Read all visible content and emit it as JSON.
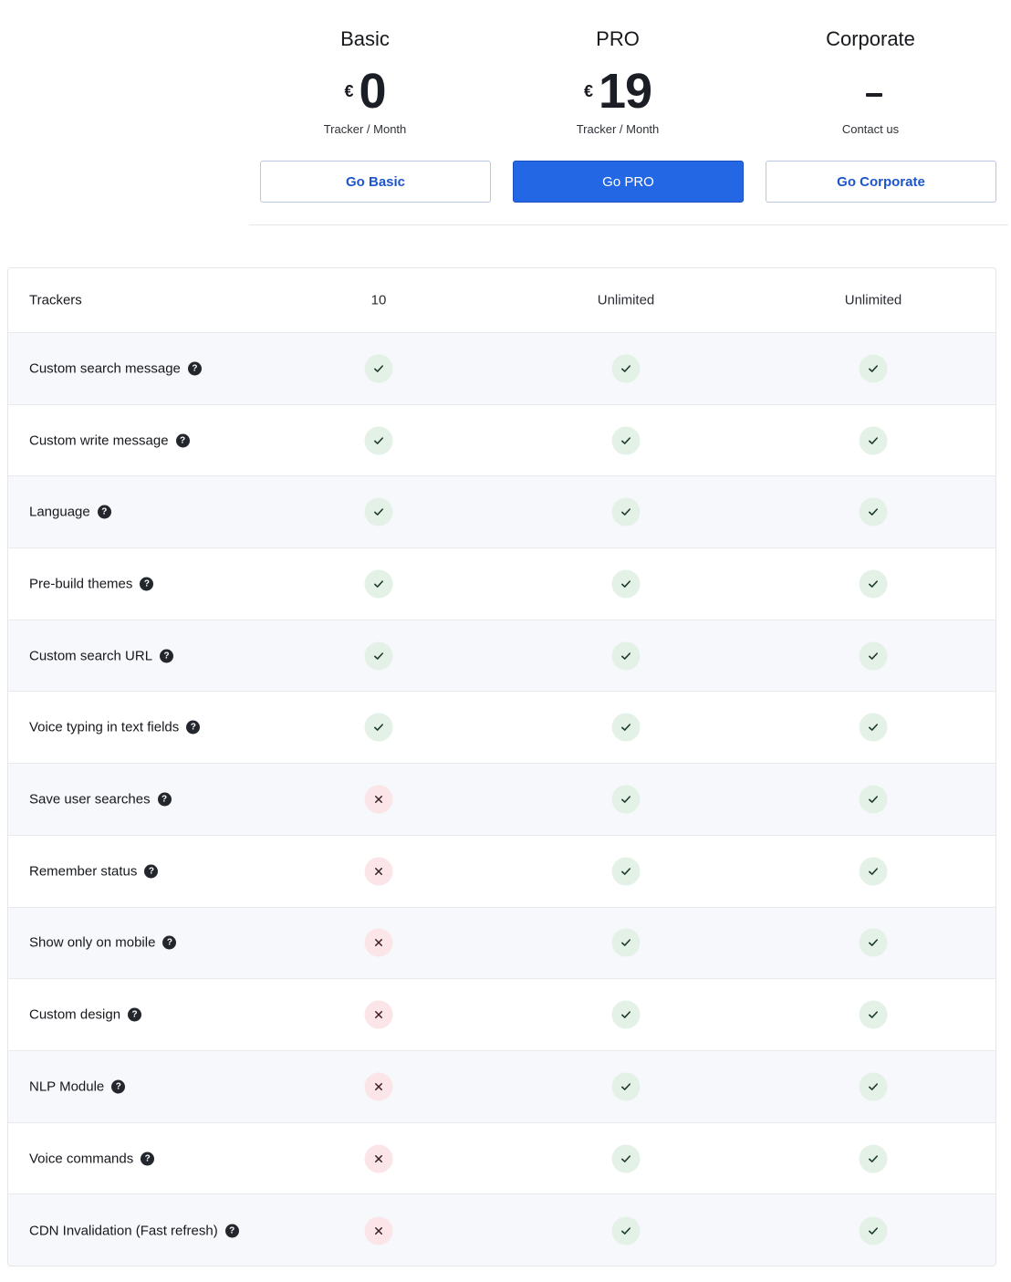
{
  "plans": [
    {
      "name": "Basic",
      "currency": "€",
      "amount": "0",
      "period": "Tracker / Month",
      "button": "Go Basic",
      "primary": false
    },
    {
      "name": "PRO",
      "currency": "€",
      "amount": "19",
      "period": "Tracker / Month",
      "button": "Go PRO",
      "primary": true
    },
    {
      "name": "Corporate",
      "currency": "",
      "amount": "-",
      "period": "Contact us",
      "button": "Go Corporate",
      "primary": false
    }
  ],
  "table": {
    "trackers": {
      "label": "Trackers",
      "values": [
        "10",
        "Unlimited",
        "Unlimited"
      ]
    },
    "features": [
      {
        "label": "Custom search message",
        "values": [
          true,
          true,
          true
        ]
      },
      {
        "label": "Custom write message",
        "values": [
          true,
          true,
          true
        ]
      },
      {
        "label": "Language",
        "values": [
          true,
          true,
          true
        ]
      },
      {
        "label": "Pre-build themes",
        "values": [
          true,
          true,
          true
        ]
      },
      {
        "label": "Custom search URL",
        "values": [
          true,
          true,
          true
        ]
      },
      {
        "label": "Voice typing in text fields",
        "values": [
          true,
          true,
          true
        ]
      },
      {
        "label": "Save user searches",
        "values": [
          false,
          true,
          true
        ]
      },
      {
        "label": "Remember status",
        "values": [
          false,
          true,
          true
        ]
      },
      {
        "label": "Show only on mobile",
        "values": [
          false,
          true,
          true
        ]
      },
      {
        "label": "Custom design",
        "values": [
          false,
          true,
          true
        ]
      },
      {
        "label": "NLP Module",
        "values": [
          false,
          true,
          true
        ]
      },
      {
        "label": "Voice commands",
        "values": [
          false,
          true,
          true
        ]
      },
      {
        "label": "CDN Invalidation (Fast refresh)",
        "values": [
          false,
          true,
          true
        ]
      }
    ]
  },
  "help_glyph": "?",
  "icons": {
    "help": "question-circle-icon",
    "yes": "check-icon",
    "no": "cross-icon"
  },
  "colors": {
    "primary": "#2467e4",
    "link": "#1c56c9",
    "check_bg": "#e3f1e7",
    "cross_bg": "#fbe5e8",
    "check_mark": "#1f3a28",
    "cross_mark": "#3a1f24"
  }
}
